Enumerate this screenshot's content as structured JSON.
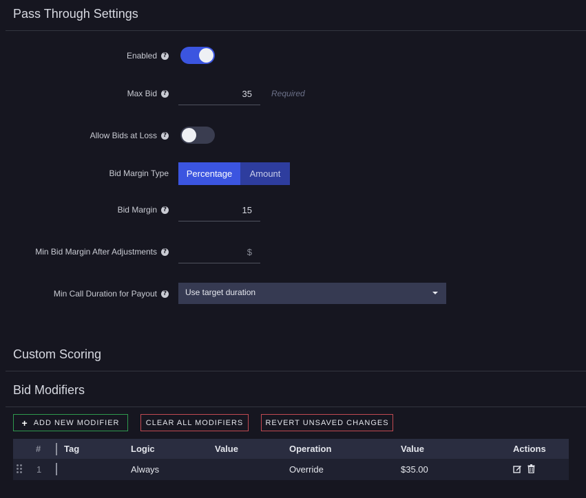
{
  "pass_through": {
    "title": "Pass Through Settings",
    "enabled": {
      "label": "Enabled",
      "on": true
    },
    "max_bid": {
      "label": "Max Bid",
      "value": "35",
      "required_hint": "Required"
    },
    "allow_bids_at_loss": {
      "label": "Allow Bids at Loss",
      "on": false
    },
    "bid_margin_type": {
      "label": "Bid Margin Type",
      "options": [
        "Percentage",
        "Amount"
      ],
      "selected": "Percentage"
    },
    "bid_margin": {
      "label": "Bid Margin",
      "value": "15"
    },
    "min_bid_margin": {
      "label": "Min Bid Margin After Adjustments",
      "placeholder": "$"
    },
    "min_call_duration": {
      "label": "Min Call Duration for Payout",
      "selected": "Use target duration"
    }
  },
  "custom_scoring": {
    "title": "Custom Scoring"
  },
  "bid_modifiers": {
    "title": "Bid Modifiers",
    "add_label": "Add New Modifier",
    "clear_label": "Clear All Modifiers",
    "revert_label": "Revert Unsaved Changes",
    "columns": [
      "#",
      "Tag",
      "Logic",
      "Value",
      "Operation",
      "Value",
      "Actions"
    ],
    "rows": [
      {
        "index": "1",
        "tag": "",
        "logic": "Always",
        "value": "",
        "operation": "Override",
        "amount": "$35.00"
      }
    ]
  },
  "colors": {
    "accent": "#3b55e0",
    "background": "#161620",
    "green": "#2f9a4e",
    "red": "#c24a52"
  },
  "icons": [
    "help-icon",
    "plus-icon",
    "chevron-down-icon",
    "edit-icon",
    "trash-icon",
    "drag-handle-icon"
  ]
}
